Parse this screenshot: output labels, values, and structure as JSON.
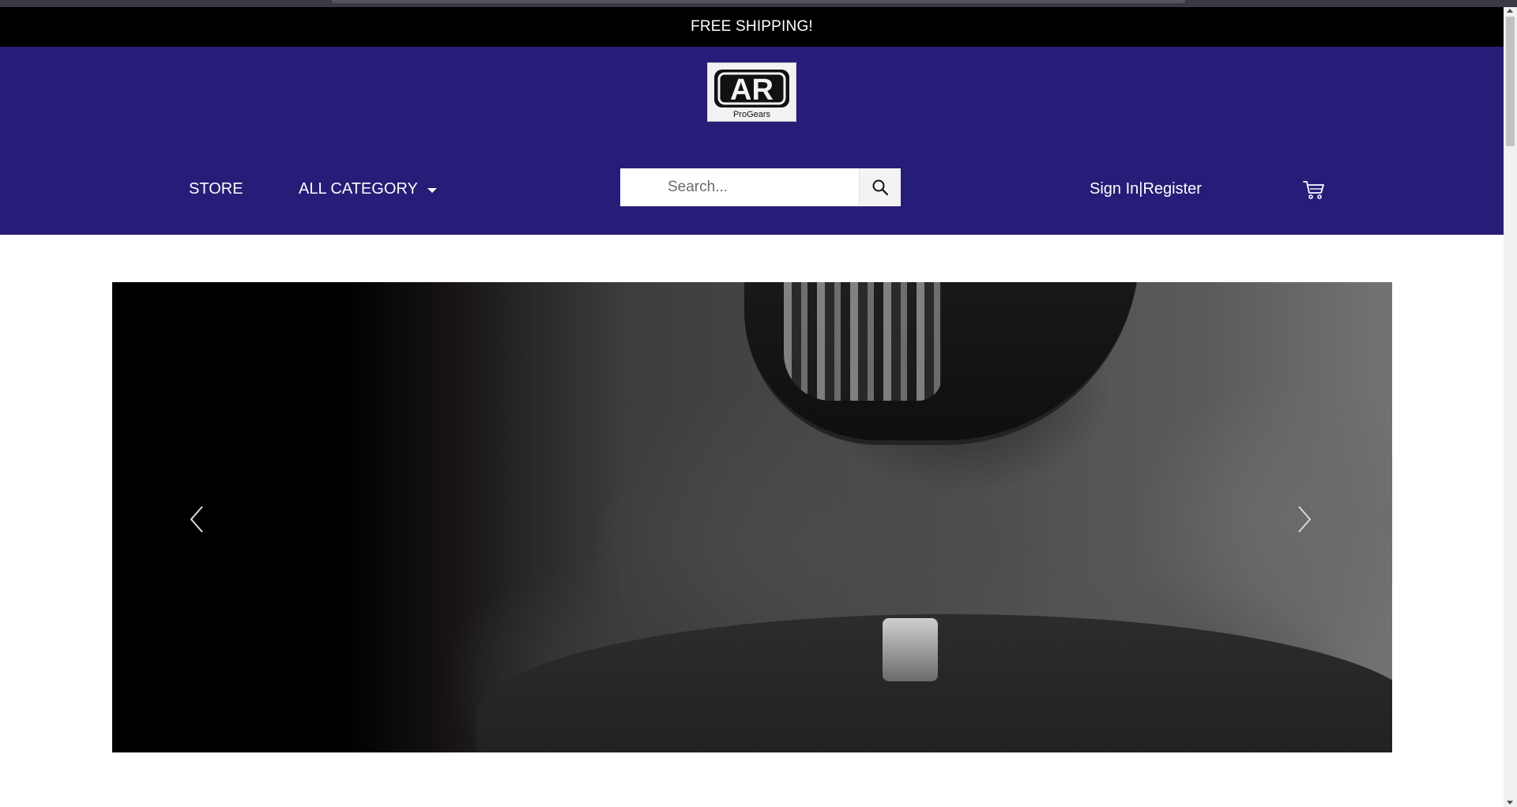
{
  "promo": {
    "text": "FREE SHIPPING!"
  },
  "brand": {
    "logo_text": "AR",
    "logo_subtext": "ProGears"
  },
  "nav": {
    "store_label": "STORE",
    "category_label": "ALL CATEGORY"
  },
  "search": {
    "placeholder": "Search...",
    "value": ""
  },
  "auth": {
    "sign_in_label": "Sign In",
    "separator": "|",
    "register_label": "Register"
  },
  "colors": {
    "header_bg": "#261d78",
    "promo_bg": "#000000",
    "text_light": "#ffffff"
  },
  "icons": {
    "search": "search-icon",
    "cart": "cart-icon",
    "prev": "chevron-left-icon",
    "next": "chevron-right-icon",
    "category_toggle": "caret-down-icon"
  }
}
